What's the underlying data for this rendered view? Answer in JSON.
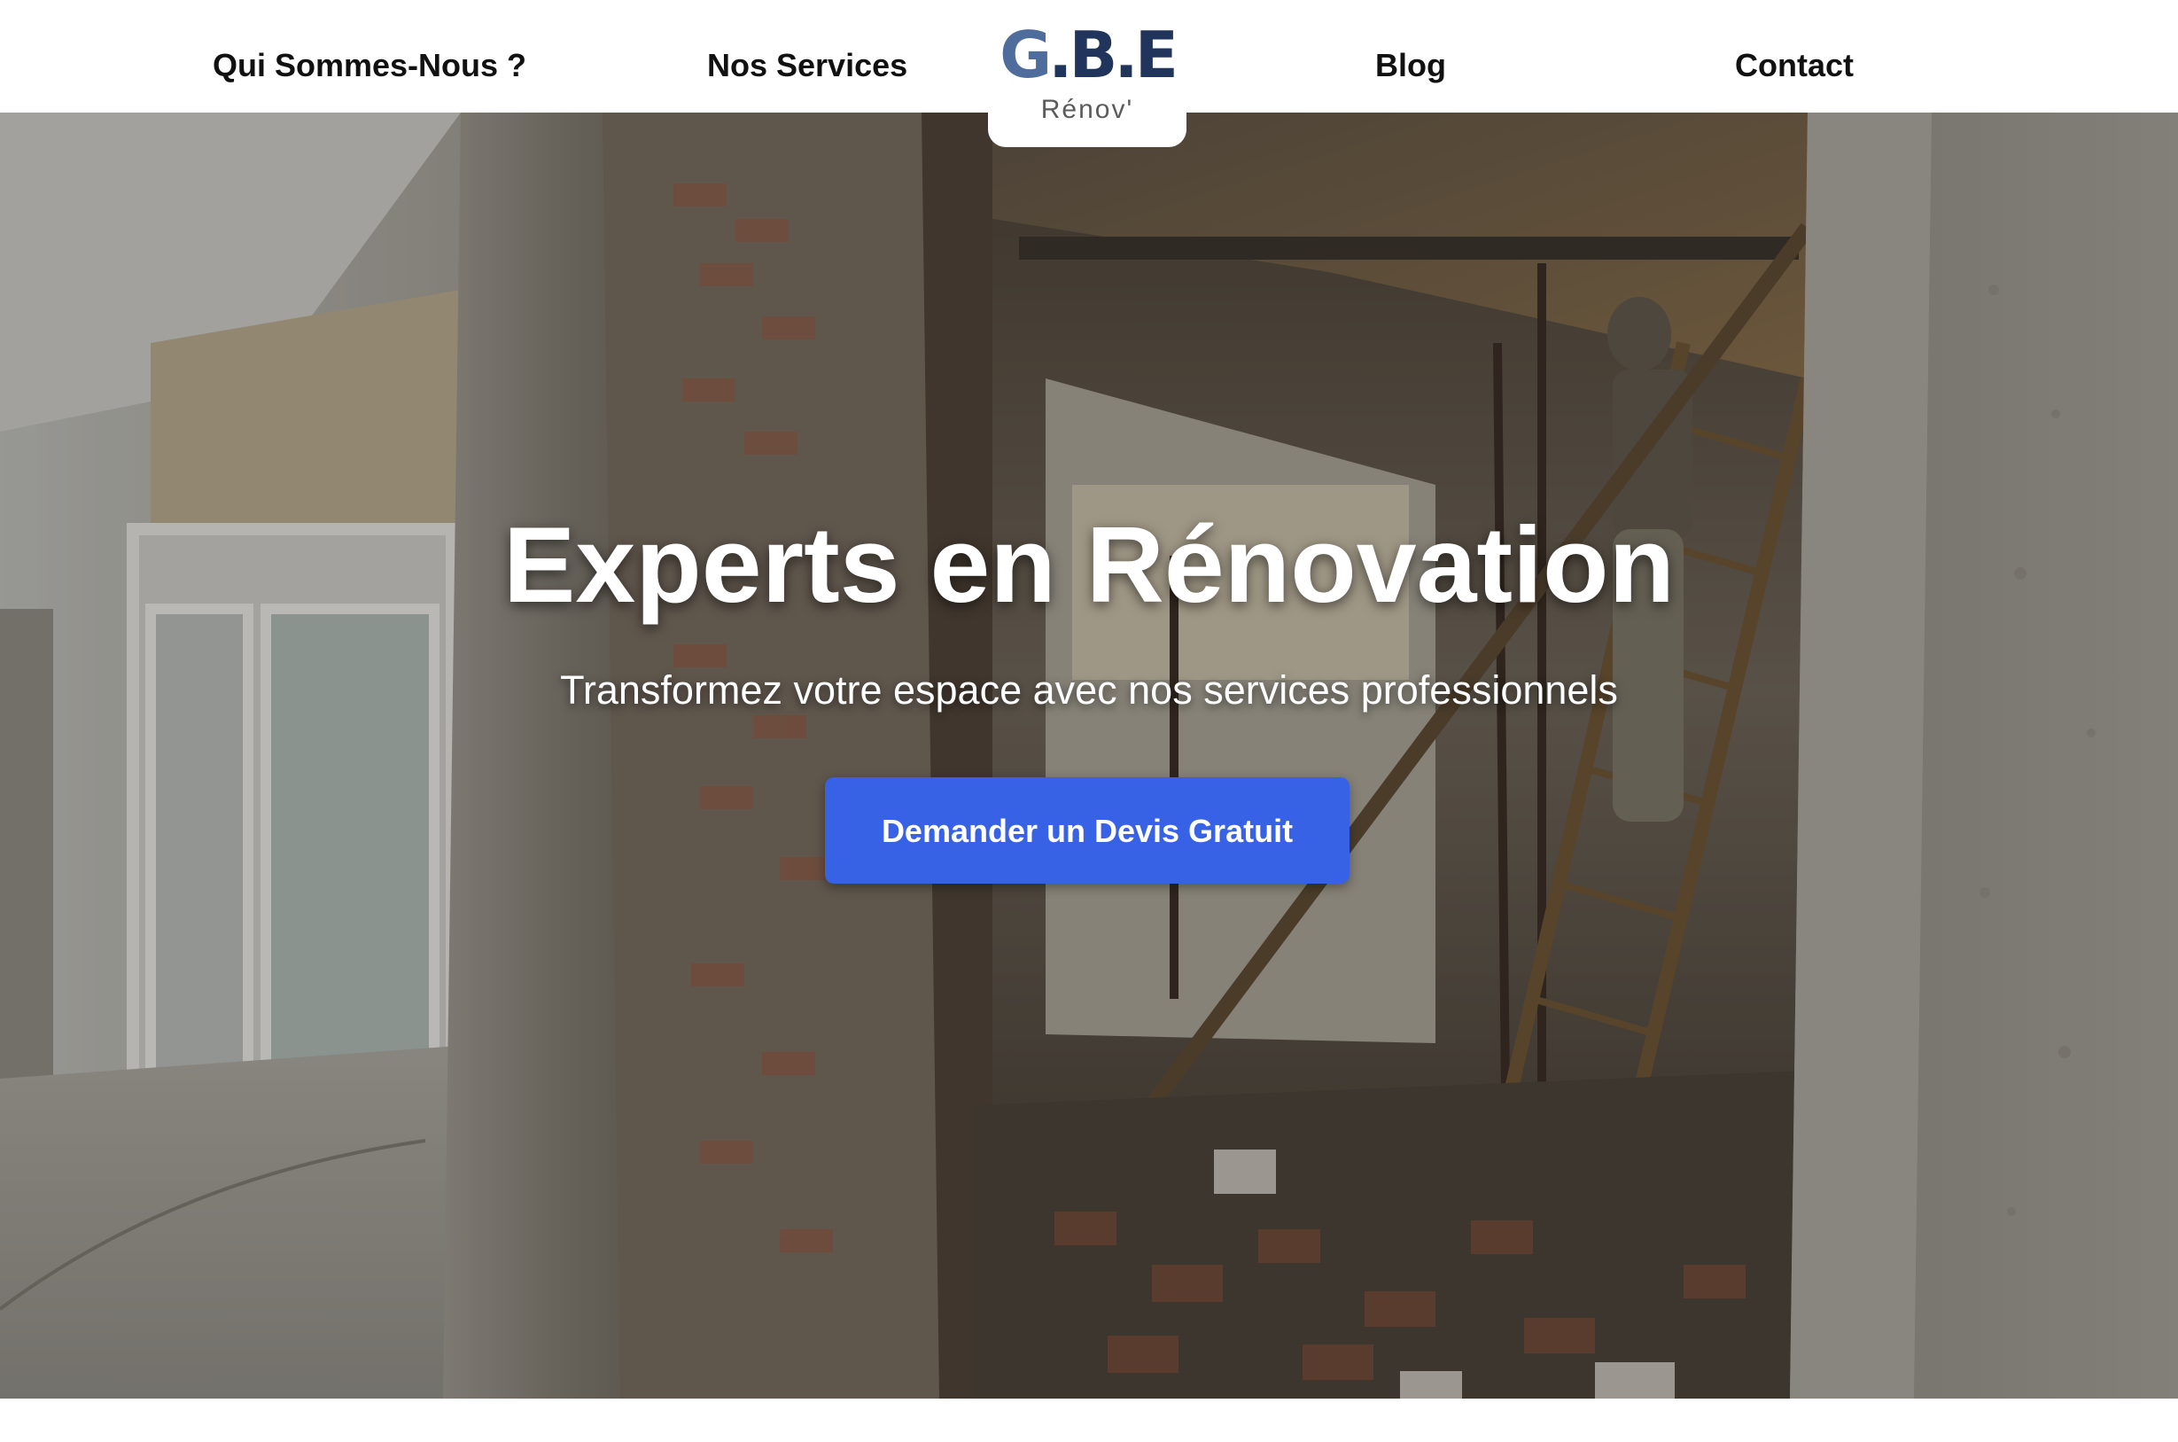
{
  "nav": {
    "about": "Qui Sommes-Nous ?",
    "services": "Nos Services",
    "blog": "Blog",
    "contact": "Contact"
  },
  "logo": {
    "mark": "G.B.E",
    "subtitle": "Rénov'"
  },
  "hero": {
    "title": "Experts en Rénovation",
    "subtitle": "Transformez votre espace avec nos services professionnels",
    "cta_label": "Demander un Devis Gratuit"
  },
  "colors": {
    "accent": "#3862e6",
    "logo_navy": "#21355c",
    "logo_blue": "#4f6d9c",
    "nav_text": "#111111"
  }
}
